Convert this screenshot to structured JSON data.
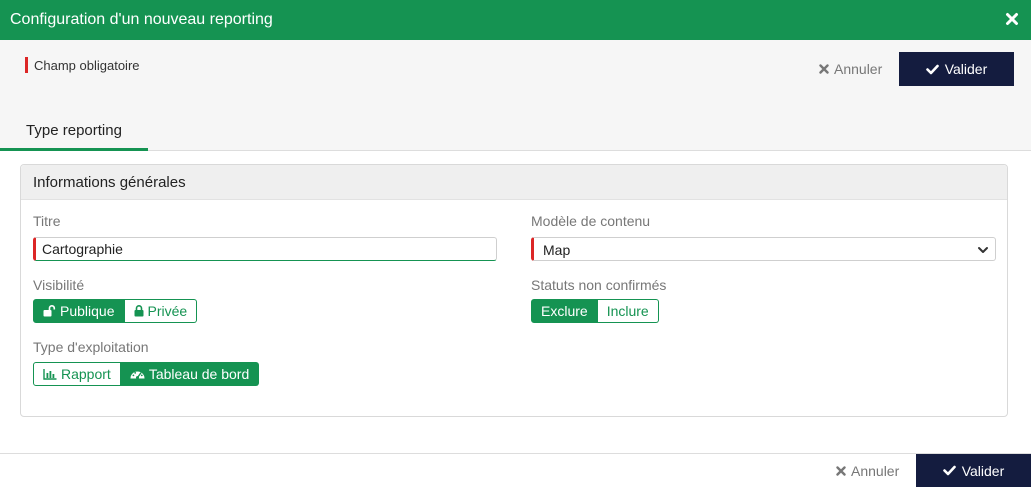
{
  "header": {
    "title": "Configuration d'un nouveau reporting",
    "close_icon": "close-icon",
    "background_color": "#159352"
  },
  "toolbar": {
    "required_note": "Champ obligatoire",
    "cancel_label": "Annuler",
    "validate_label": "Valider"
  },
  "tabs": [
    {
      "label": "Type reporting",
      "active": true
    }
  ],
  "panel": {
    "title": "Informations générales",
    "title_field": {
      "label": "Titre",
      "value": "Cartographie"
    },
    "model_field": {
      "label": "Modèle de contenu",
      "value": "Map"
    },
    "visibility": {
      "label": "Visibilité",
      "options": [
        {
          "label": "Publique",
          "icon": "unlock-icon",
          "active": true
        },
        {
          "label": "Privée",
          "icon": "lock-icon",
          "active": false
        }
      ]
    },
    "unconfirmed_status": {
      "label": "Statuts non confirmés",
      "options": [
        {
          "label": "Exclure",
          "active": true
        },
        {
          "label": "Inclure",
          "active": false
        }
      ]
    },
    "exploitation_type": {
      "label": "Type d'exploitation",
      "options": [
        {
          "label": "Rapport",
          "icon": "bar-chart-icon",
          "active": false
        },
        {
          "label": "Tableau de bord",
          "icon": "dashboard-icon",
          "active": true
        }
      ]
    }
  },
  "footer": {
    "cancel_label": "Annuler",
    "validate_label": "Valider"
  },
  "colors": {
    "accent": "#159352",
    "primary_button": "#141c3f",
    "required_marker": "#dc2626"
  }
}
